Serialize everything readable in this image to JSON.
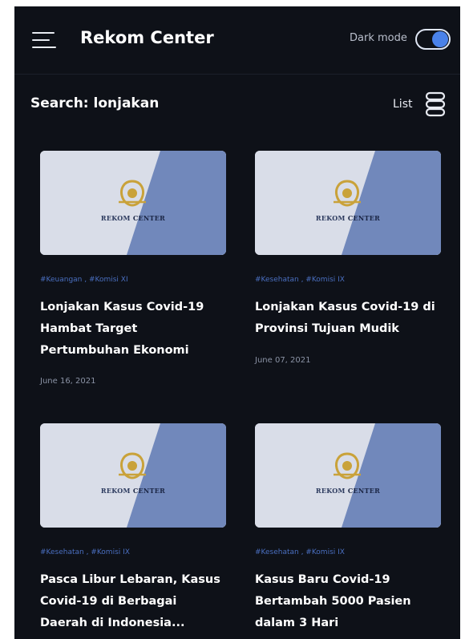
{
  "header": {
    "app_title": "Rekom Center",
    "dark_mode_label": "Dark mode",
    "dark_mode_on": true
  },
  "search": {
    "title": "Search: lonjakan"
  },
  "view_toggle": {
    "label": "List"
  },
  "colors": {
    "background": "#0e1118",
    "accent": "#4a82ea",
    "tag": "#4a6fc0",
    "thumb_light": "#d8dce7",
    "thumb_dark": "#6f86b8"
  },
  "thumbnail_logo_text": {
    "part1": "REKOM",
    "part2": "CENTER"
  },
  "articles": [
    {
      "tags": "#Keuangan , #Komisi XI",
      "title": "Lonjakan Kasus Covid-19 Hambat Target Pertumbuhan Ekonomi",
      "date": "June 16, 2021"
    },
    {
      "tags": "#Kesehatan , #Komisi IX",
      "title": "Lonjakan Kasus Covid-19 di Provinsi Tujuan Mudik",
      "date": "June 07, 2021"
    },
    {
      "tags": "#Kesehatan , #Komisi IX",
      "title": "Pasca Libur Lebaran, Kasus Covid-19 di Berbagai Daerah di Indonesia...",
      "date": ""
    },
    {
      "tags": "#Kesehatan , #Komisi IX",
      "title": "Kasus Baru Covid-19 Bertambah 5000 Pasien dalam 3 Hari",
      "date": ""
    }
  ]
}
